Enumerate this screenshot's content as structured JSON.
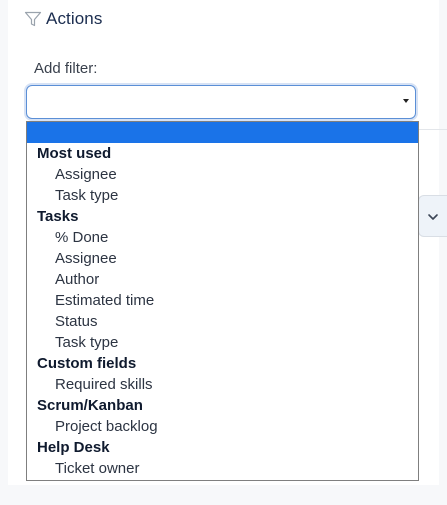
{
  "header": {
    "title": "Actions",
    "icon": "filter-icon"
  },
  "filter": {
    "label": "Add filter:",
    "selected": "",
    "dropdown_groups": [
      {
        "label": "Most used",
        "options": [
          "Assignee",
          "Task type"
        ]
      },
      {
        "label": "Tasks",
        "options": [
          "% Done",
          "Assignee",
          "Author",
          "Estimated time",
          "Status",
          "Task type"
        ]
      },
      {
        "label": "Custom fields",
        "options": [
          "Required skills"
        ]
      },
      {
        "label": "Scrum/Kanban",
        "options": [
          "Project backlog"
        ]
      },
      {
        "label": "Help Desk",
        "options": [
          "Ticket owner"
        ]
      }
    ]
  },
  "colors": {
    "highlight": "#1a73e8",
    "focus_border": "#5b8fd6",
    "title_text": "#1b2d4f"
  }
}
